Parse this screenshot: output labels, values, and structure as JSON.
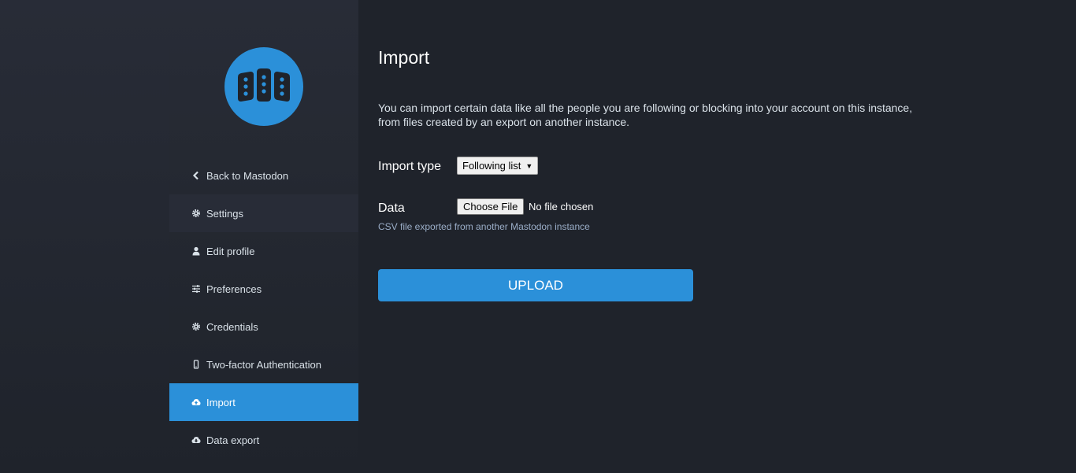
{
  "brand": {
    "accent": "#2b90d9",
    "logo_icon": "mastodon-logo"
  },
  "sidebar": {
    "items": [
      {
        "label": "Back to Mastodon",
        "icon": "chevron-left-icon"
      },
      {
        "label": "Settings",
        "icon": "gear-icon"
      },
      {
        "label": "Edit profile",
        "icon": "user-icon"
      },
      {
        "label": "Preferences",
        "icon": "sliders-icon"
      },
      {
        "label": "Credentials",
        "icon": "gear-icon"
      },
      {
        "label": "Two-factor Authentication",
        "icon": "mobile-icon"
      },
      {
        "label": "Import",
        "icon": "cloud-upload-icon",
        "active": true
      },
      {
        "label": "Data export",
        "icon": "cloud-download-icon"
      }
    ]
  },
  "main": {
    "title": "Import",
    "intro": "You can import certain data like all the people you are following or blocking into your account on this instance, from files created by an export on another instance.",
    "import_type": {
      "label": "Import type",
      "selected": "Following list"
    },
    "data_field": {
      "label": "Data",
      "button": "Choose File",
      "status": "No file chosen",
      "hint": "CSV file exported from another Mastodon instance"
    },
    "submit": "UPLOAD"
  }
}
